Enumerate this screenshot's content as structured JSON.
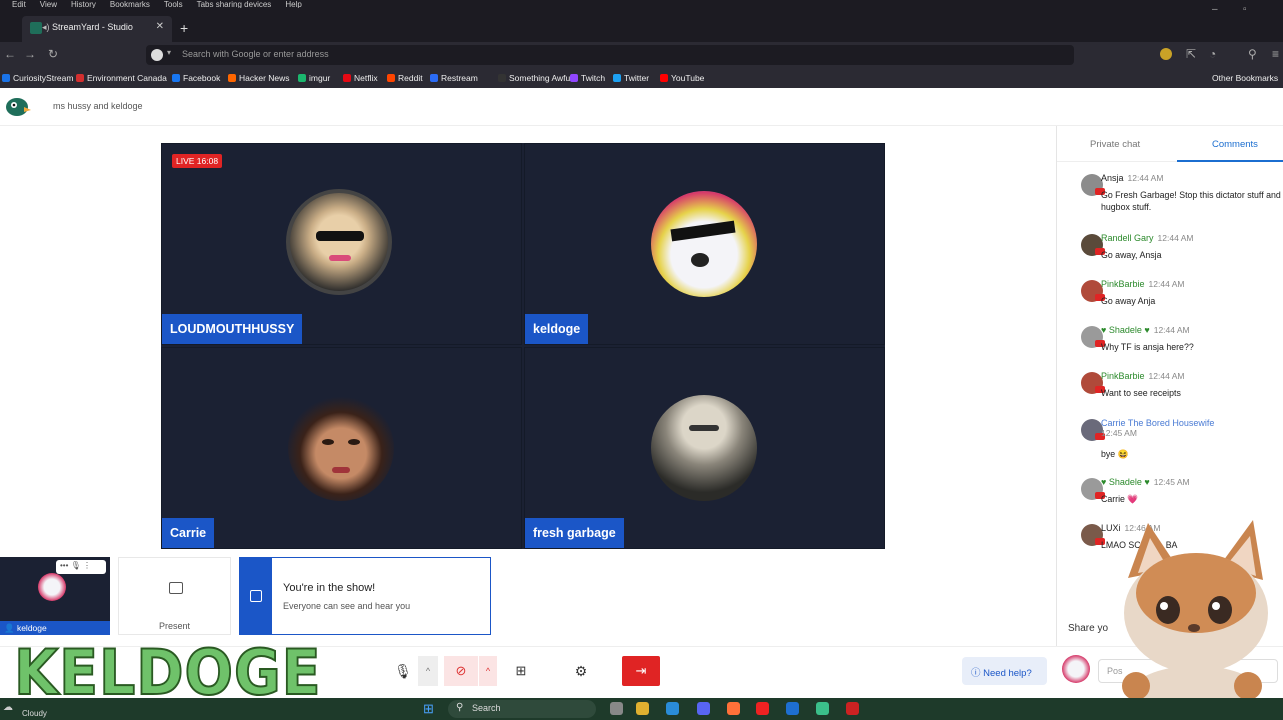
{
  "browser": {
    "menu": [
      "Edit",
      "View",
      "History",
      "Bookmarks",
      "Tools",
      "Tabs sharing devices",
      "Help"
    ],
    "tab_title": "StreamYard - Studio",
    "address_placeholder": "Search with Google or enter address",
    "bookmarks": [
      {
        "label": "CuriosityStream",
        "color": "#1a73e8"
      },
      {
        "label": "Environment Canada",
        "color": "#d32f2f"
      },
      {
        "label": "Facebook",
        "color": "#1877f2"
      },
      {
        "label": "Hacker News",
        "color": "#ff6600"
      },
      {
        "label": "imgur",
        "color": "#1bb76e"
      },
      {
        "label": "Netflix",
        "color": "#e50914"
      },
      {
        "label": "Reddit",
        "color": "#ff4500"
      },
      {
        "label": "Restream",
        "color": "#2b6cf6"
      },
      {
        "label": "Something Awful",
        "color": "#333333"
      },
      {
        "label": "Twitch",
        "color": "#9146ff"
      },
      {
        "label": "Twitter",
        "color": "#1da1f2"
      },
      {
        "label": "YouTube",
        "color": "#ff0000"
      }
    ],
    "other_bookmarks": "Other Bookmarks"
  },
  "app": {
    "show_title": "ms hussy and keldoge",
    "live_badge": "LIVE 16:08"
  },
  "participants": [
    {
      "name": "LOUDMOUTHHUSSY",
      "avatar_colors": [
        "#d9c3a0",
        "#1a1a1a"
      ]
    },
    {
      "name": "keldoge",
      "avatar_colors": [
        "#e8e8f0",
        "#d63a6a"
      ]
    },
    {
      "name": "Carrie",
      "avatar_colors": [
        "#7a4a32",
        "#2d1a12"
      ]
    },
    {
      "name": "fresh garbage",
      "avatar_colors": [
        "#a9a499",
        "#2b2b28"
      ]
    }
  ],
  "chat": {
    "tabs": [
      "Private chat",
      "Comments"
    ],
    "active_tab": "Comments",
    "messages": [
      {
        "author": "Ansja",
        "time": "12:44 AM",
        "text": "Go Fresh Garbage! Stop this dictator stuff and hugbox stuff.",
        "style": "default",
        "avatar": "#8c8c8c"
      },
      {
        "author": "Randell Gary",
        "time": "12:44 AM",
        "text": "Go away, Ansja",
        "style": "green",
        "avatar": "#5a4a3a"
      },
      {
        "author": "PinkBarbie",
        "time": "12:44 AM",
        "text": "Go away Anja",
        "style": "green",
        "avatar": "#b04a3a"
      },
      {
        "author": "♥ Shadele ♥",
        "time": "12:44 AM",
        "text": "Why TF is ansja here??",
        "style": "green",
        "avatar": "#9a9a9a"
      },
      {
        "author": "PinkBarbie",
        "time": "12:44 AM",
        "text": "Want to see receipts",
        "style": "green",
        "avatar": "#b04a3a"
      },
      {
        "author": "Carrie The Bored Housewife",
        "time": "12:45 AM",
        "text": "bye 😆",
        "style": "blue",
        "avatar": "#6a6a7a"
      },
      {
        "author": "♥ Shadele ♥",
        "time": "12:45 AM",
        "text": "Carrie 💗",
        "style": "green",
        "avatar": "#9a9a9a"
      },
      {
        "author": "LUXi",
        "time": "12:46 AM",
        "text": "LMAO SCROLL BA",
        "style": "default",
        "avatar": "#7a5a4a"
      }
    ],
    "share_label": "Share yo",
    "comment_placeholder": "Pos"
  },
  "bottom": {
    "self_name": "keldoge",
    "present_label": "Present",
    "toast_title": "You're in the show!",
    "toast_sub": "Everyone can see and hear you",
    "help_label": "Need help?",
    "overlay_text": "KELDOGE"
  },
  "taskbar": {
    "weather": "Cloudy",
    "search": "Search"
  }
}
